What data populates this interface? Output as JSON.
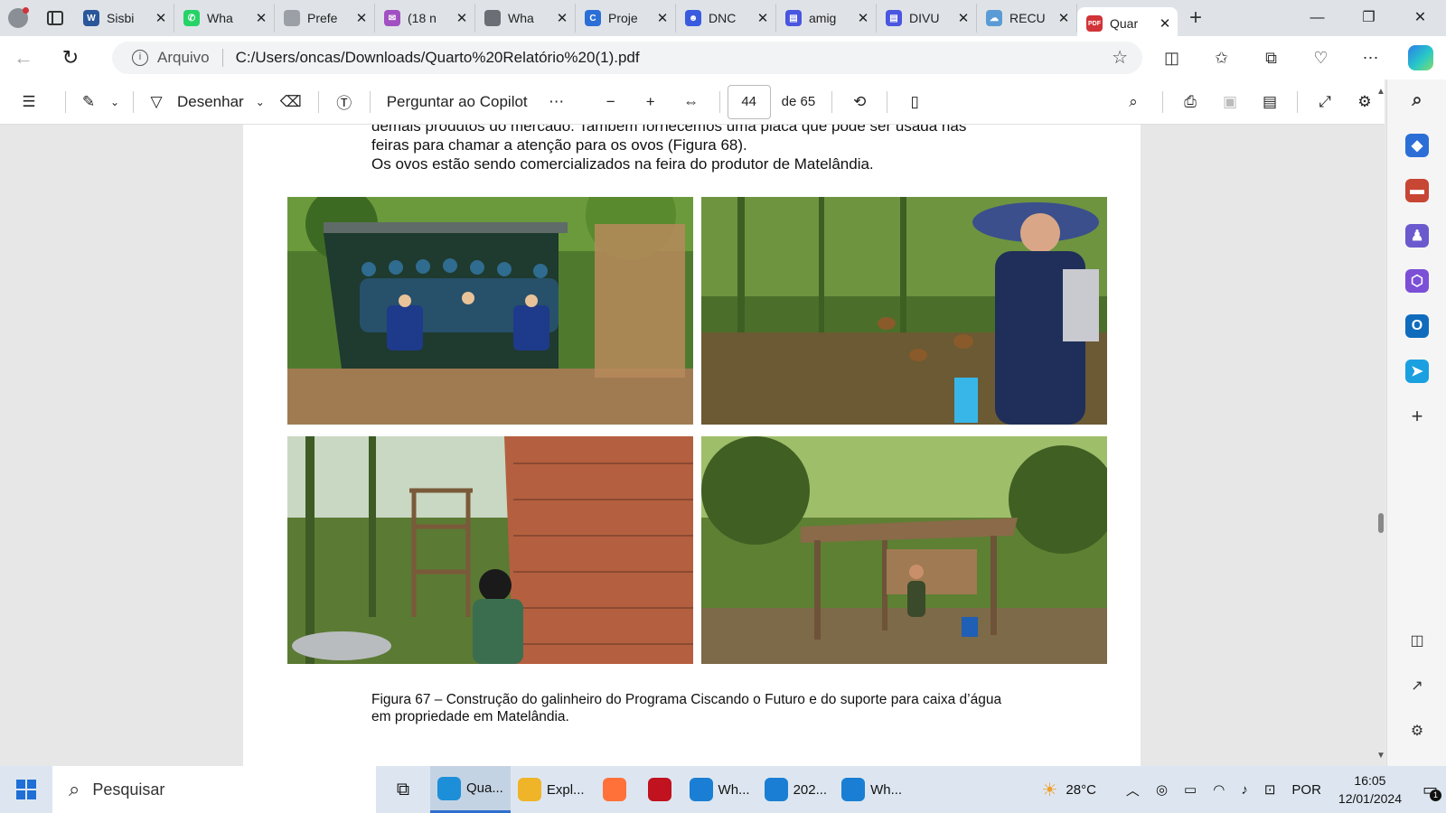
{
  "tabs": [
    {
      "title": "Sisbi",
      "icon": "word-icon",
      "color": "#2b579a",
      "letter": "W"
    },
    {
      "title": "Wha",
      "icon": "whatsapp-icon",
      "color": "#25d366",
      "letter": "✆"
    },
    {
      "title": "Prefe",
      "icon": "document-icon",
      "color": "#9aa0a6",
      "letter": ""
    },
    {
      "title": "(18 n",
      "icon": "mail-icon",
      "color": "#a14fc2",
      "letter": "✉"
    },
    {
      "title": "Wha",
      "icon": "cube-icon",
      "color": "#6b6f75",
      "letter": ""
    },
    {
      "title": "Proje",
      "icon": "loop-icon",
      "color": "#2b6fd6",
      "letter": "C"
    },
    {
      "title": "DNC",
      "icon": "copilot-chat-icon",
      "color": "#3a5be0",
      "letter": "☻"
    },
    {
      "title": "amig",
      "icon": "printer-app-icon",
      "color": "#4a55e0",
      "letter": "▤"
    },
    {
      "title": "DIVU",
      "icon": "printer-app-icon",
      "color": "#4a55e0",
      "letter": "▤"
    },
    {
      "title": "RECU",
      "icon": "onedrive-icon",
      "color": "#5b9bd5",
      "letter": "☁"
    },
    {
      "title": "Quar",
      "icon": "pdf-icon",
      "color": "#d13438",
      "letter": "PDF",
      "active": true
    }
  ],
  "address": {
    "scheme_label": "Arquivo",
    "url": "C:/Users/oncas/Downloads/Quarto%20Relatório%20(1).pdf"
  },
  "pdf_toolbar": {
    "draw_label": "Desenhar",
    "copilot_label": "Perguntar ao Copilot",
    "page_current": "44",
    "page_total": "de 65"
  },
  "document": {
    "line1": "demais produtos do mercado. Também fornecemos uma placa que pode ser usada nas",
    "line2": "feiras para chamar a atenção para os ovos (Figura 68).",
    "line3": "Os ovos estão sendo comercializados na feira do produtor de Matelândia.",
    "caption": "Figura 67 – Construção do galinheiro do Programa Ciscando o Futuro e do suporte para caixa d’água em propriedade em Matelândia."
  },
  "taskbar": {
    "search_placeholder": "Pesquisar",
    "apps": [
      {
        "label": "Qua...",
        "icon": "edge-icon",
        "color": "#1c8fd8",
        "active": true
      },
      {
        "label": "Expl...",
        "icon": "file-explorer-icon",
        "color": "#f0b429"
      },
      {
        "label": "",
        "icon": "firefox-icon",
        "color": "#ff7139"
      },
      {
        "label": "",
        "icon": "red-app-icon",
        "color": "#c1121f"
      },
      {
        "label": "Wh...",
        "icon": "photo-editor-icon",
        "color": "#1a7fd4"
      },
      {
        "label": "202...",
        "icon": "photo-editor-icon",
        "color": "#1a7fd4"
      },
      {
        "label": "Wh...",
        "icon": "photo-editor-icon",
        "color": "#1a7fd4"
      }
    ],
    "weather": "28°C",
    "language": "POR",
    "time": "16:05",
    "date": "12/01/2024",
    "notifications": "1"
  }
}
